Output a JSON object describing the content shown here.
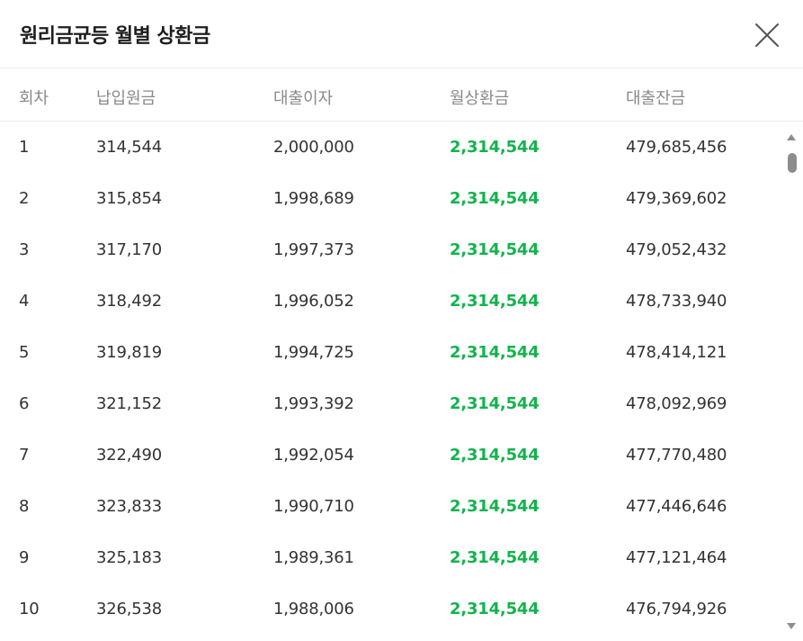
{
  "modal": {
    "title": "원리금균등 월별 상환금",
    "close_icon": "close-icon"
  },
  "table": {
    "headers": [
      "회차",
      "납입원금",
      "대출이자",
      "월상환금",
      "대출잔금"
    ],
    "rows": [
      {
        "no": "1",
        "principal": "314,544",
        "interest": "2,000,000",
        "payment": "2,314,544",
        "balance": "479,685,456"
      },
      {
        "no": "2",
        "principal": "315,854",
        "interest": "1,998,689",
        "payment": "2,314,544",
        "balance": "479,369,602"
      },
      {
        "no": "3",
        "principal": "317,170",
        "interest": "1,997,373",
        "payment": "2,314,544",
        "balance": "479,052,432"
      },
      {
        "no": "4",
        "principal": "318,492",
        "interest": "1,996,052",
        "payment": "2,314,544",
        "balance": "478,733,940"
      },
      {
        "no": "5",
        "principal": "319,819",
        "interest": "1,994,725",
        "payment": "2,314,544",
        "balance": "478,414,121"
      },
      {
        "no": "6",
        "principal": "321,152",
        "interest": "1,993,392",
        "payment": "2,314,544",
        "balance": "478,092,969"
      },
      {
        "no": "7",
        "principal": "322,490",
        "interest": "1,992,054",
        "payment": "2,314,544",
        "balance": "477,770,480"
      },
      {
        "no": "8",
        "principal": "323,833",
        "interest": "1,990,710",
        "payment": "2,314,544",
        "balance": "477,446,646"
      },
      {
        "no": "9",
        "principal": "325,183",
        "interest": "1,989,361",
        "payment": "2,314,544",
        "balance": "477,121,464"
      },
      {
        "no": "10",
        "principal": "326,538",
        "interest": "1,988,006",
        "payment": "2,314,544",
        "balance": "476,794,926"
      }
    ]
  },
  "colors": {
    "payment_text": "#12b34c",
    "header_text": "#8a8a8a",
    "body_text": "#333333",
    "divider": "#ececec"
  }
}
